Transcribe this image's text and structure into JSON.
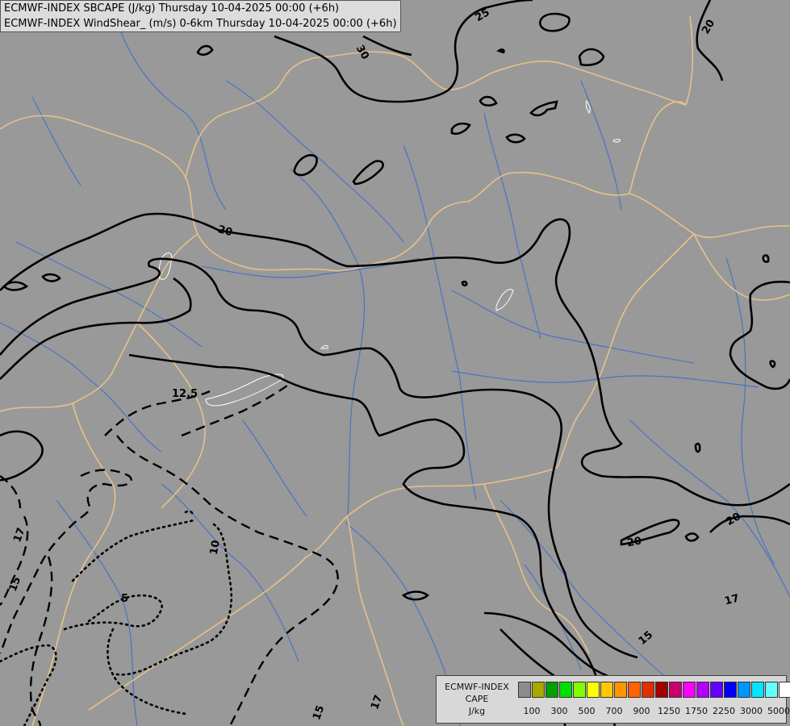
{
  "header": {
    "line1": "ECMWF-INDEX SBCAPE (J/kg) Thursday 10-04-2025 00:00 (+6h)",
    "line2": "ECMWF-INDEX WindShear_ (m/s) 0-6km Thursday 10-04-2025 00:00 (+6h)"
  },
  "contour_labels": [
    "25",
    "30",
    "20",
    "20",
    "20",
    "20",
    "12.5",
    "10",
    "5",
    "17",
    "15",
    "17",
    "15",
    "15",
    "17"
  ],
  "legend": {
    "title_line1": "ECMWF-INDEX",
    "title_line2": "CAPE",
    "units": "J/kg",
    "colors": [
      "#8c8c8c",
      "#a8a800",
      "#00a000",
      "#00e000",
      "#80ff00",
      "#ffff00",
      "#ffc800",
      "#ff9600",
      "#ff6400",
      "#e03000",
      "#a00000",
      "#c8006e",
      "#ff00ff",
      "#b400ff",
      "#6400ff",
      "#0000ff",
      "#0096ff",
      "#00e6ff",
      "#64ffff",
      "#ffffff"
    ],
    "ticks": [
      "100",
      "300",
      "500",
      "700",
      "900",
      "1250",
      "1750",
      "2250",
      "3000",
      "5000"
    ]
  },
  "colors": {
    "background": "#999999",
    "borders": "#e8c08a",
    "rivers": "#3c6ec8",
    "contours": "#000000"
  }
}
